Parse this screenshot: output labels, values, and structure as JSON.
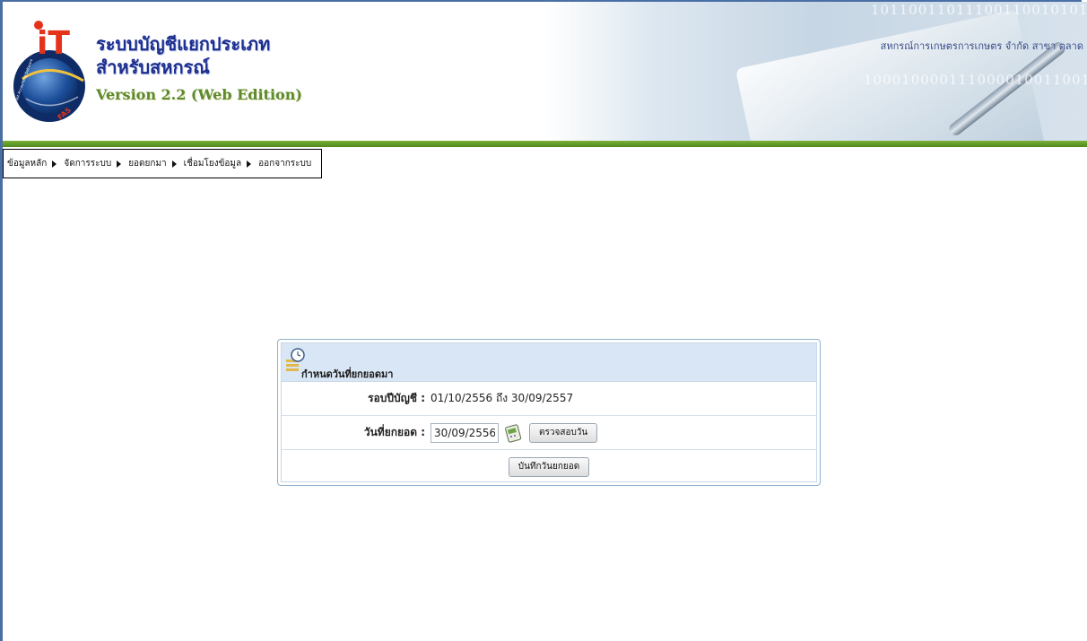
{
  "header": {
    "title_line1": "ระบบบัญชีแยกประเภท",
    "title_line2": "สำหรับสหกรณ์",
    "version": "Version 2.2 (Web Edition)",
    "coop_name": "สหกรณ์การเกษตรการเกษตร จำกัด สาขา ตลาด",
    "binary_top": "1011001101110011001010101",
    "binary_mid": "10001000011100001001100101",
    "logo_letters": "iT",
    "logo_fas": "FAS",
    "logo_ring_text": "Fast Accounting Software"
  },
  "menu": {
    "items": [
      {
        "label": "ข้อมูลหลัก"
      },
      {
        "label": "จัดการระบบ"
      },
      {
        "label": "ยอดยกมา"
      },
      {
        "label": "เชื่อมโยงข้อมูล"
      },
      {
        "label": "ออกจากระบบ"
      }
    ]
  },
  "panel": {
    "title": "กำหนดวันที่ยกยอดมา",
    "fiscal_label": "รอบปีบัญชี :",
    "fiscal_value": "01/10/2556 ถึง 30/09/2557",
    "date_label": "วันที่ยกยอด :",
    "date_value": "30/09/2556",
    "check_button": "ตรวจสอบวัน",
    "save_button": "บันทึกวันยกยอด"
  },
  "colors": {
    "frame": "#4a6fa5",
    "green_bar": "#5e9a26",
    "panel_header": "#d9e6f5",
    "title_blue": "#1c2e8f",
    "version_green": "#5c8a2c"
  }
}
